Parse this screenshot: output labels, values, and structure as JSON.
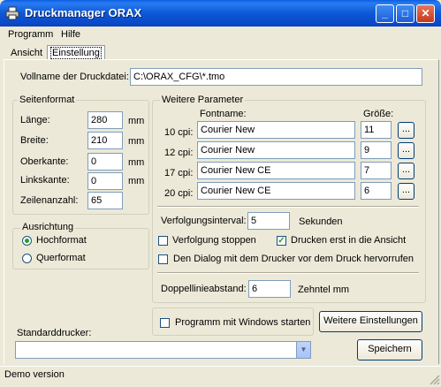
{
  "window": {
    "title": "Druckmanager ORAX",
    "minimize": "_",
    "maximize": "□",
    "close": "✕"
  },
  "menu": {
    "items": [
      "Programm",
      "Hilfe"
    ]
  },
  "tabs": [
    {
      "label": "Ansicht"
    },
    {
      "label": "Einstellung"
    }
  ],
  "file": {
    "label": "Vollname der Druckdatei:",
    "value": "C:\\ORAX_CFG\\*.tmo"
  },
  "seitenformat": {
    "title": "Seitenformat",
    "rows": [
      {
        "label": "Länge:",
        "value": "280",
        "unit": "mm"
      },
      {
        "label": "Breite:",
        "value": "210",
        "unit": "mm"
      },
      {
        "label": "Oberkante:",
        "value": "0",
        "unit": "mm"
      },
      {
        "label": "Linkskante:",
        "value": "0",
        "unit": "mm"
      },
      {
        "label": "Zeilenanzahl:",
        "value": "65",
        "unit": ""
      }
    ]
  },
  "ausrichtung": {
    "title": "Ausrichtung",
    "options": [
      {
        "label": "Hochformat",
        "selected": true
      },
      {
        "label": "Querformat",
        "selected": false
      }
    ]
  },
  "weitere": {
    "title": "Weitere Parameter",
    "col_font": "Fontname:",
    "col_size": "Größe:",
    "fonts": [
      {
        "label": "10 cpi:",
        "font": "Courier New",
        "size": "11",
        "btn": "..."
      },
      {
        "label": "12 cpi:",
        "font": "Courier New",
        "size": "9",
        "btn": "..."
      },
      {
        "label": "17 cpi:",
        "font": "Courier New CE",
        "size": "7",
        "btn": "..."
      },
      {
        "label": "20 cpi:",
        "font": "Courier New CE",
        "size": "6",
        "btn": "..."
      }
    ],
    "interval_label": "Verfolgungsinterval:",
    "interval_value": "5",
    "interval_unit": "Sekunden",
    "cb_stop": {
      "label": "Verfolgung stoppen",
      "checked": false
    },
    "cb_drucken": {
      "label": "Drucken erst in die Ansicht",
      "checked": true
    },
    "cb_dialog": {
      "label": "Den Dialog mit dem Drucker vor dem Druck hervorrufen",
      "checked": false
    },
    "doppel_label": "Doppellinieabstand:",
    "doppel_value": "6",
    "doppel_unit": "Zehntel mm"
  },
  "startup": {
    "label": "Programm mit Windows starten",
    "checked": false
  },
  "more_settings": "Weitere Einstellungen",
  "standarddrucker": {
    "label": "Standarddrucker:",
    "value": ""
  },
  "save": "Speichern",
  "status": "Demo version",
  "colors": {
    "titlebar": "#0a58d6",
    "face": "#ece9d8",
    "check": "#21a121"
  }
}
